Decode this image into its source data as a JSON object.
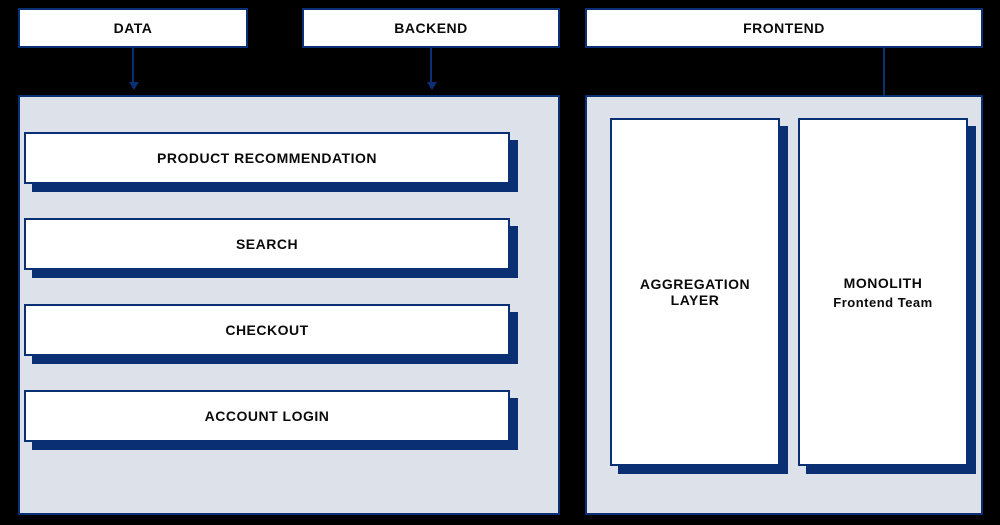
{
  "headers": {
    "data": "DATA",
    "backend": "BACKEND",
    "frontend": "FRONTEND"
  },
  "left_panel": {
    "items": [
      "PRODUCT RECOMMENDATION",
      "SEARCH",
      "CHECKOUT",
      "ACCOUNT LOGIN"
    ]
  },
  "right_panel": {
    "aggregation": {
      "title": "AGGREGATION LAYER"
    },
    "monolith": {
      "title": "MONOLITH",
      "subtitle": "Frontend Team"
    }
  },
  "colors": {
    "border": "#0a2f73",
    "panel_bg": "#dde1e9",
    "canvas_bg": "#000000"
  }
}
